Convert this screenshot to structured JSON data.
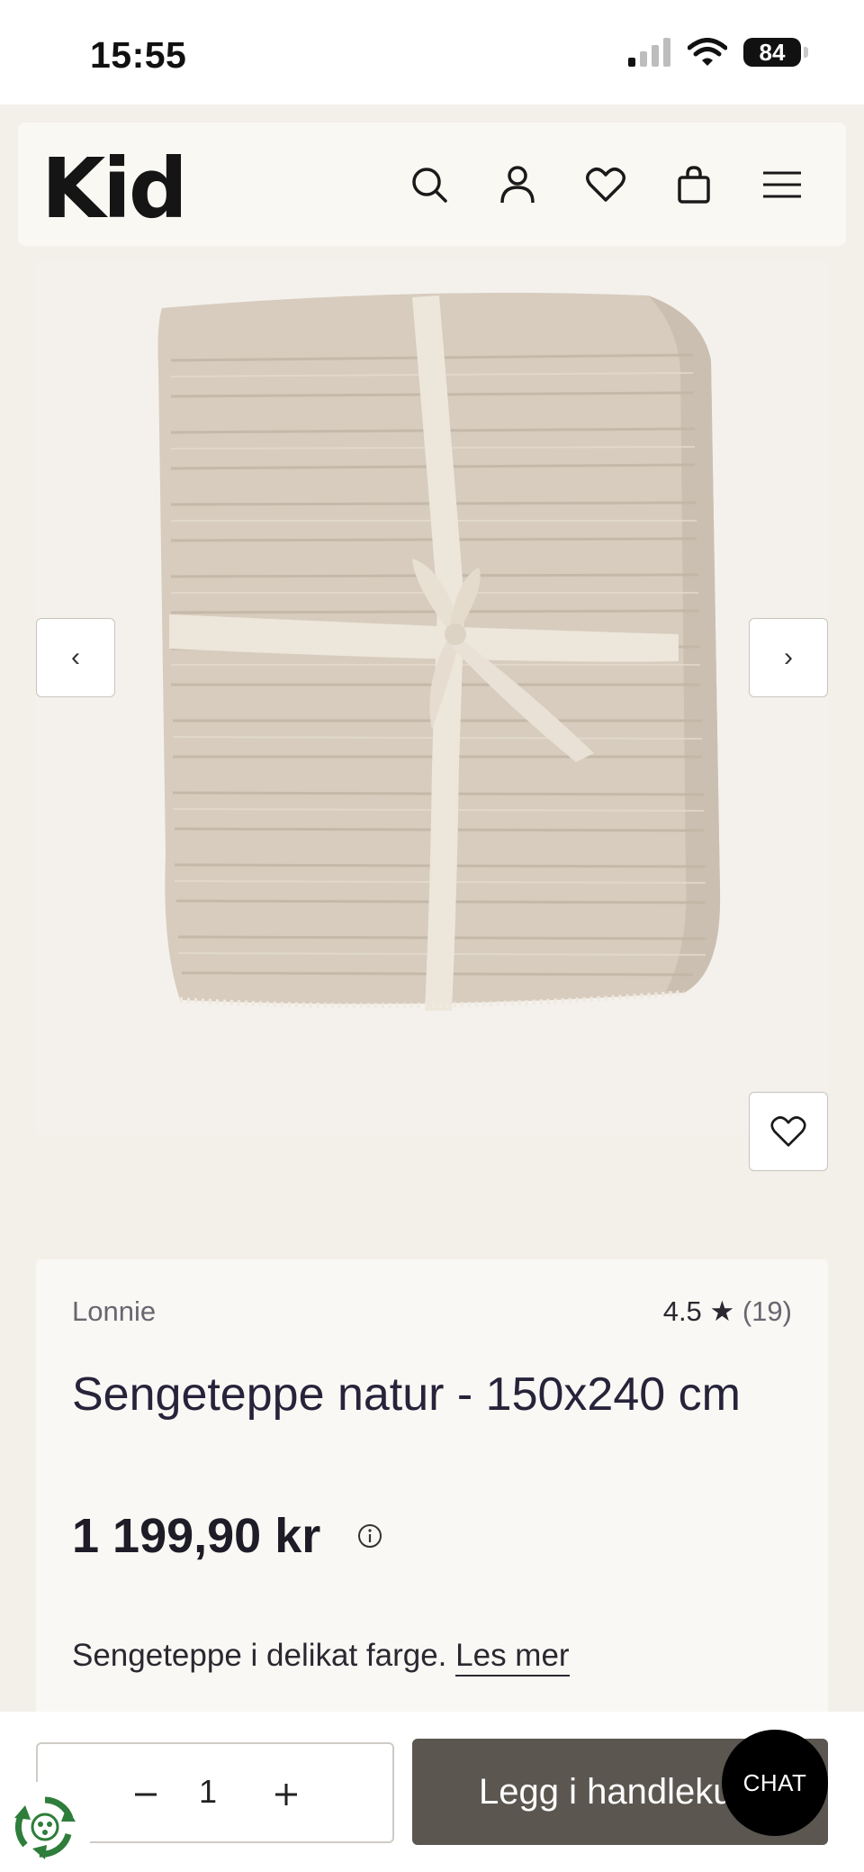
{
  "status_bar": {
    "time": "15:55",
    "battery": "84"
  },
  "header": {
    "logo": "Kid",
    "icons": [
      "search-icon",
      "account-icon",
      "wishlist-icon",
      "cart-icon",
      "menu-icon"
    ]
  },
  "gallery": {
    "prev_label": "‹",
    "next_label": "›",
    "image_alt": "Sengeteppe natur"
  },
  "product": {
    "brand": "Lonnie",
    "rating": "4.5",
    "rating_star": "★",
    "review_count": "(19)",
    "title": "Sengeteppe natur - 150x240 cm",
    "price": "1 199,90 kr",
    "description": "Sengeteppe i delikat farge.",
    "read_more": "Les mer"
  },
  "cart_bar": {
    "quantity": "1",
    "add_to_cart": "Legg i handlekurv"
  },
  "chat": {
    "label": "CHAT"
  },
  "colors": {
    "background": "#f3efe9",
    "card": "#faf8f4",
    "button_dark": "#5b5650",
    "blanket": "#d6cbbd",
    "ribbon": "#ede6da"
  }
}
